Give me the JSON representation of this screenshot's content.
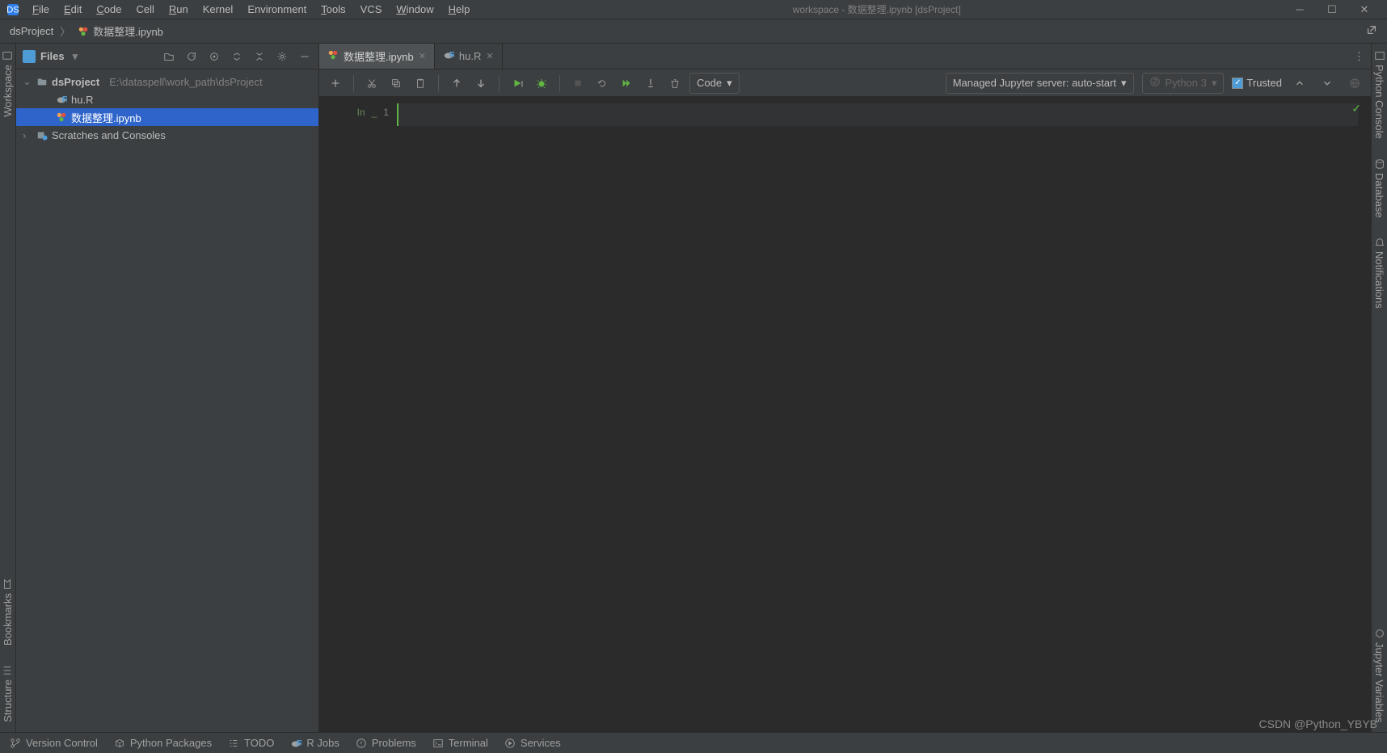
{
  "window": {
    "title": "workspace - 数据整理.ipynb [dsProject]"
  },
  "menubar": [
    {
      "label": "File",
      "accel": "F"
    },
    {
      "label": "Edit",
      "accel": "E"
    },
    {
      "label": "Code",
      "accel": "C"
    },
    {
      "label": "Cell",
      "accel": ""
    },
    {
      "label": "Run",
      "accel": "R"
    },
    {
      "label": "Kernel",
      "accel": ""
    },
    {
      "label": "Environment",
      "accel": ""
    },
    {
      "label": "Tools",
      "accel": "T"
    },
    {
      "label": "VCS",
      "accel": ""
    },
    {
      "label": "Window",
      "accel": "W"
    },
    {
      "label": "Help",
      "accel": "H"
    }
  ],
  "breadcrumb": {
    "root": "dsProject",
    "file": "数据整理.ipynb"
  },
  "left_gutter": {
    "workspace": "Workspace",
    "bookmarks": "Bookmarks",
    "structure": "Structure"
  },
  "right_gutter": {
    "python_console": "Python Console",
    "database": "Database",
    "notifications": "Notifications",
    "jupyter_vars": "Jupyter Variables"
  },
  "project_panel": {
    "title": "Files",
    "root": {
      "name": "dsProject",
      "path": "E:\\dataspell\\work_path\\dsProject"
    },
    "children": [
      {
        "name": "hu.R",
        "type": "r"
      },
      {
        "name": "数据整理.ipynb",
        "type": "ipynb",
        "selected": true
      }
    ],
    "scratches": "Scratches and Consoles"
  },
  "tabs": [
    {
      "label": "数据整理.ipynb",
      "type": "ipynb",
      "active": true
    },
    {
      "label": "hu.R",
      "type": "r",
      "active": false
    }
  ],
  "toolbar": {
    "cell_type": "Code",
    "server": "Managed Jupyter server: auto-start",
    "kernel": "Python 3",
    "trusted": "Trusted"
  },
  "cell": {
    "in_label": "In",
    "idx": "1"
  },
  "bottom": {
    "version_control": "Version Control",
    "python_packages": "Python Packages",
    "todo": "TODO",
    "r_jobs": "R Jobs",
    "problems": "Problems",
    "terminal": "Terminal",
    "services": "Services"
  },
  "watermark": "CSDN @Python_YBYB"
}
